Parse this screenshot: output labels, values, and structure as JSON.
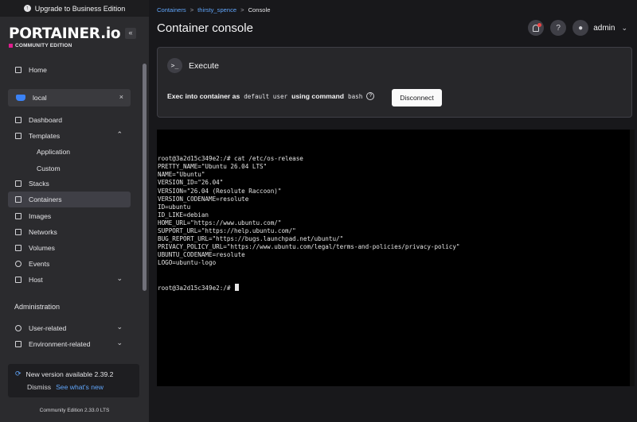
{
  "sidebar": {
    "upgrade_label": "Upgrade to Business Edition",
    "logo_text": "PORTAINER.io",
    "edition_label": "COMMUNITY EDITION",
    "collapse_glyph": "«",
    "home_label": "Home",
    "environment": {
      "name": "local",
      "close_glyph": "×"
    },
    "items": {
      "dashboard": "Dashboard",
      "templates": "Templates",
      "templates_application": "Application",
      "templates_custom": "Custom",
      "stacks": "Stacks",
      "containers": "Containers",
      "images": "Images",
      "networks": "Networks",
      "volumes": "Volumes",
      "events": "Events",
      "host": "Host"
    },
    "admin_title": "Administration",
    "admin_items": {
      "user_related": "User-related",
      "environment_related": "Environment-related"
    },
    "update": {
      "text": "New version available 2.39.2",
      "dismiss": "Dismiss",
      "link": "See what's new"
    },
    "footer_version": "Community Edition 2.33.0 LTS"
  },
  "header": {
    "breadcrumb": [
      "Containers",
      "thirsty_spence",
      "Console"
    ],
    "title": "Container console",
    "user": "admin"
  },
  "exec": {
    "title": "Execute",
    "prefix": "Exec into container as",
    "user": "default user",
    "middle": "using command",
    "command": "bash",
    "disconnect_label": "Disconnect"
  },
  "terminal": {
    "lines": [
      "root@3a2d15c349e2:/# cat /etc/os-release",
      "PRETTY_NAME=\"Ubuntu 26.04 LTS\"",
      "NAME=\"Ubuntu\"",
      "VERSION_ID=\"26.04\"",
      "VERSION=\"26.04 (Resolute Raccoon)\"",
      "VERSION_CODENAME=resolute",
      "ID=ubuntu",
      "ID_LIKE=debian",
      "HOME_URL=\"https://www.ubuntu.com/\"",
      "SUPPORT_URL=\"https://help.ubuntu.com/\"",
      "BUG_REPORT_URL=\"https://bugs.launchpad.net/ubuntu/\"",
      "PRIVACY_POLICY_URL=\"https://www.ubuntu.com/legal/terms-and-policies/privacy-policy\"",
      "UBUNTU_CODENAME=resolute",
      "LOGO=ubuntu-logo"
    ],
    "prompt": "root@3a2d15c349e2:/# "
  },
  "colors": {
    "accent_link": "#60a5fa",
    "sidebar_bg": "#2b2b2e",
    "main_bg": "#18181b",
    "notification_dot": "#ef4444"
  },
  "icons": {
    "upgrade": "arrow-up-circle-icon",
    "notifications": "bell-icon",
    "help": "question-circle-icon",
    "user": "user-avatar-icon",
    "terminal": "terminal-prompt-icon",
    "docker": "docker-whale-icon"
  }
}
